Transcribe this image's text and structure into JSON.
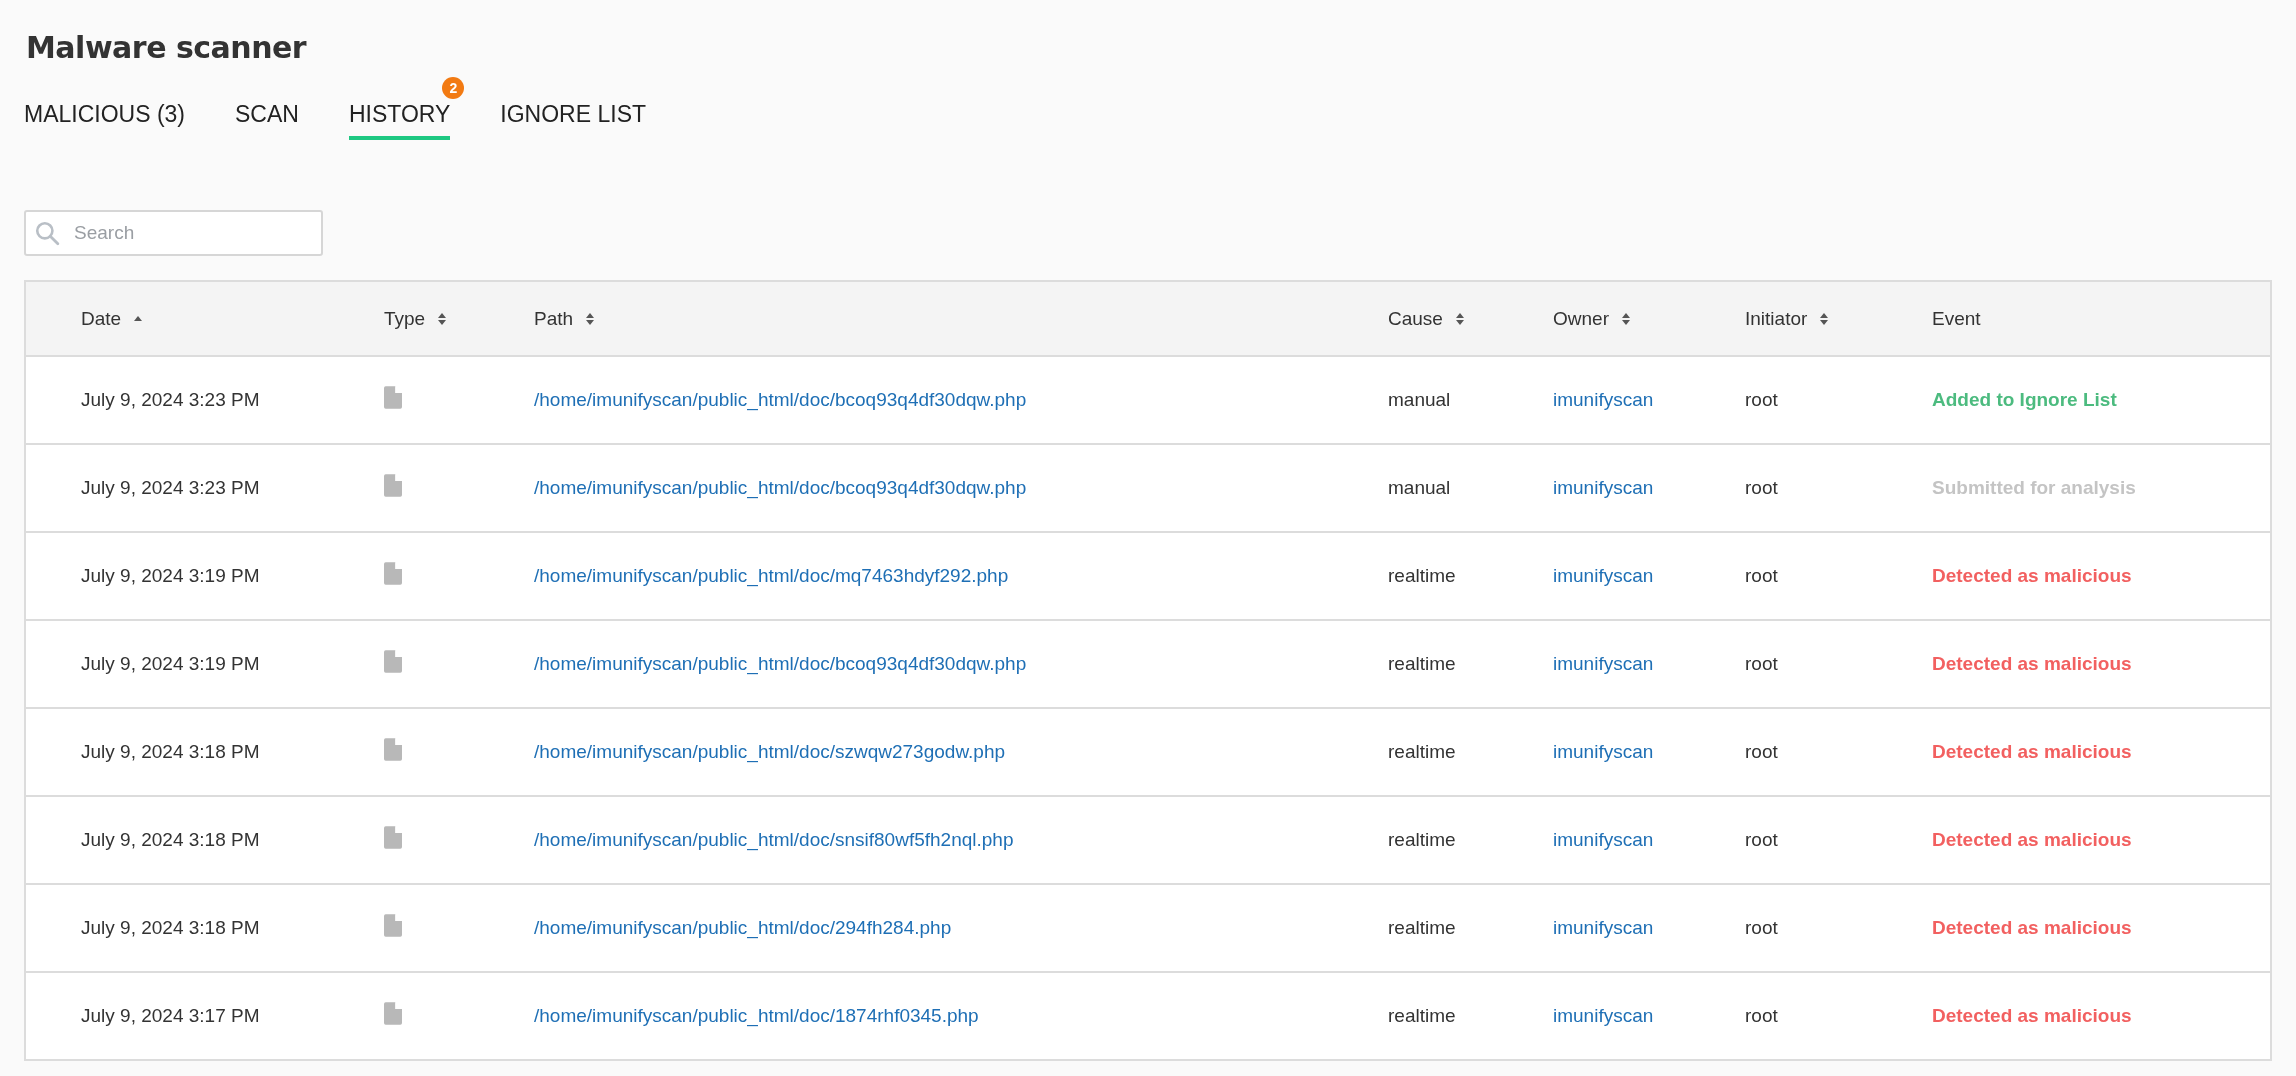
{
  "title": "Malware scanner",
  "tabs": [
    {
      "label": "MALICIOUS (3)",
      "selected": false
    },
    {
      "label": "SCAN",
      "selected": false
    },
    {
      "label": "HISTORY",
      "selected": true,
      "badge": "2"
    },
    {
      "label": "IGNORE LIST",
      "selected": false
    }
  ],
  "search": {
    "placeholder": "Search"
  },
  "table": {
    "columns": [
      {
        "label": "Date",
        "sortable": true,
        "sorted": true
      },
      {
        "label": "Type",
        "sortable": true,
        "sorted": false
      },
      {
        "label": "Path",
        "sortable": true,
        "sorted": false
      },
      {
        "label": "Cause",
        "sortable": true,
        "sorted": false
      },
      {
        "label": "Owner",
        "sortable": true,
        "sorted": false
      },
      {
        "label": "Initiator",
        "sortable": true,
        "sorted": false
      },
      {
        "label": "Event",
        "sortable": false
      }
    ],
    "rows": [
      {
        "date": "July 9, 2024 3:23 PM",
        "path": "/home/imunifyscan/public_html/doc/bcoq93q4df30dqw.php",
        "cause": "manual",
        "owner": "imunifyscan",
        "initiator": "root",
        "event": {
          "text": "Added to Ignore List",
          "kind": "ignored"
        }
      },
      {
        "date": "July 9, 2024 3:23 PM",
        "path": "/home/imunifyscan/public_html/doc/bcoq93q4df30dqw.php",
        "cause": "manual",
        "owner": "imunifyscan",
        "initiator": "root",
        "event": {
          "text": "Submitted for analysis",
          "kind": "submitted"
        }
      },
      {
        "date": "July 9, 2024 3:19 PM",
        "path": "/home/imunifyscan/public_html/doc/mq7463hdyf292.php",
        "cause": "realtime",
        "owner": "imunifyscan",
        "initiator": "root",
        "event": {
          "text": "Detected as malicious",
          "kind": "malicious"
        }
      },
      {
        "date": "July 9, 2024 3:19 PM",
        "path": "/home/imunifyscan/public_html/doc/bcoq93q4df30dqw.php",
        "cause": "realtime",
        "owner": "imunifyscan",
        "initiator": "root",
        "event": {
          "text": "Detected as malicious",
          "kind": "malicious"
        }
      },
      {
        "date": "July 9, 2024 3:18 PM",
        "path": "/home/imunifyscan/public_html/doc/szwqw273godw.php",
        "cause": "realtime",
        "owner": "imunifyscan",
        "initiator": "root",
        "event": {
          "text": "Detected as malicious",
          "kind": "malicious"
        }
      },
      {
        "date": "July 9, 2024 3:18 PM",
        "path": "/home/imunifyscan/public_html/doc/snsif80wf5fh2nql.php",
        "cause": "realtime",
        "owner": "imunifyscan",
        "initiator": "root",
        "event": {
          "text": "Detected as malicious",
          "kind": "malicious"
        }
      },
      {
        "date": "July 9, 2024 3:18 PM",
        "path": "/home/imunifyscan/public_html/doc/294fh284.php",
        "cause": "realtime",
        "owner": "imunifyscan",
        "initiator": "root",
        "event": {
          "text": "Detected as malicious",
          "kind": "malicious"
        }
      },
      {
        "date": "July 9, 2024 3:17 PM",
        "path": "/home/imunifyscan/public_html/doc/1874rhf0345.php",
        "cause": "realtime",
        "owner": "imunifyscan",
        "initiator": "root",
        "event": {
          "text": "Detected as malicious",
          "kind": "malicious"
        }
      }
    ]
  }
}
